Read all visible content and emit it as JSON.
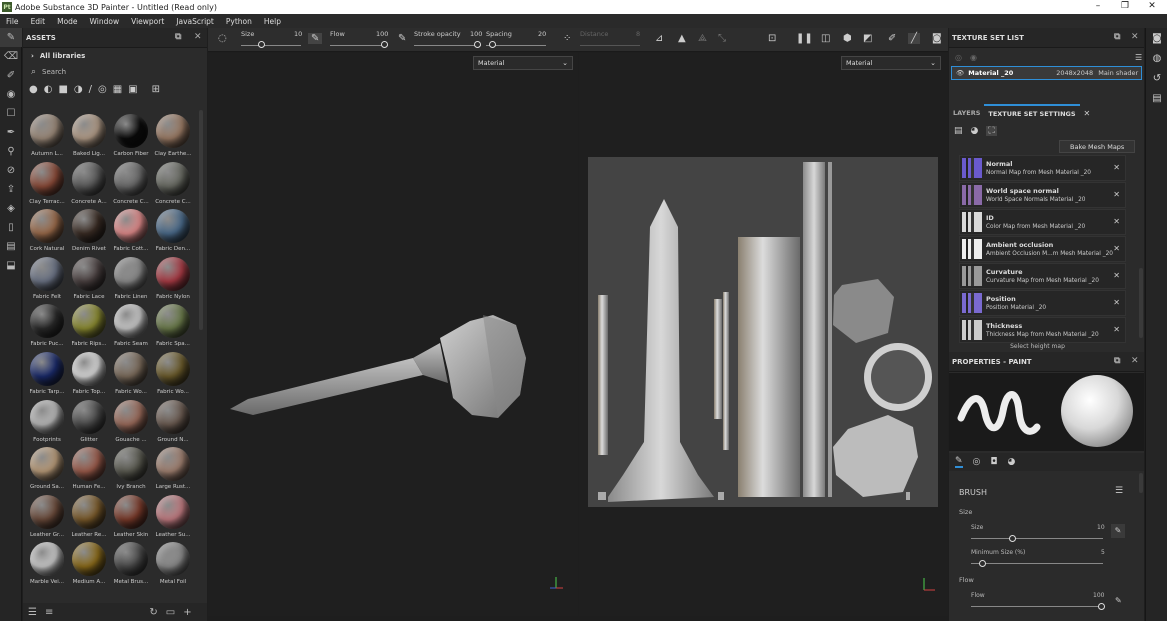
{
  "window": {
    "title": "Adobe Substance 3D Painter - Untitled (Read only)",
    "logo": "Pt",
    "minimize": "–",
    "restore": "❐",
    "close": "✕"
  },
  "menu": [
    "File",
    "Edit",
    "Mode",
    "Window",
    "Viewport",
    "JavaScript",
    "Python",
    "Help"
  ],
  "assets": {
    "title": "ASSETS",
    "library": "All libraries",
    "search_placeholder": "Search",
    "items": [
      "Autumn L...",
      "Baked Lig...",
      "Carbon Fiber",
      "Clay Earthe...",
      "Clay Terrac...",
      "Concrete A...",
      "Concrete C...",
      "Concrete C...",
      "Cork Natural",
      "Denim Rivet",
      "Fabric Cott...",
      "Fabric Den...",
      "Fabric Felt",
      "Fabric Lace",
      "Fabric Linen",
      "Fabric Nylon",
      "Fabric Puc...",
      "Fabric Rips...",
      "Fabric Seam",
      "Fabric Spa...",
      "Fabric Tarp...",
      "Fabric Top...",
      "Fabric Wo...",
      "Fabric Wo...",
      "Footprints",
      "Glitter",
      "Gouache ...",
      "Ground N...",
      "Ground Sa...",
      "Human Fe...",
      "Ivy Branch",
      "Large Rust...",
      "Leather Gr...",
      "Leather Re...",
      "Leather Skin",
      "Leather Su...",
      "Marble Vei...",
      "Medium A...",
      "Metal Brus...",
      "Metal Foil"
    ],
    "colors": [
      "#9a8878",
      "#b09a86",
      "#0a0a0a",
      "#9a7a64",
      "#8a4a38",
      "#5a5a5a",
      "#6a6a6a",
      "#686a62",
      "#9a6a4a",
      "#3a2c24",
      "#e08a8a",
      "#4a6a8a",
      "#6a7284",
      "#4a4040",
      "#8a8a8a",
      "#a83a44",
      "#2a2a2a",
      "#8a8a30",
      "#c8c8c8",
      "#6a7a4a",
      "#1a2a6a",
      "#d8d8d8",
      "#7a6a5a",
      "#6a5a2a",
      "#b8b8b8",
      "#4a4a4a",
      "#9a6a5a",
      "#6a5a50",
      "#b89a78",
      "#9a5a4a",
      "#5a5a50",
      "#a08070",
      "#6a4a3a",
      "#7a5a2a",
      "#7a3a2a",
      "#c07a80",
      "#c8c8c8",
      "#8a6a1a",
      "#4a4a4a",
      "#8a8a8a"
    ]
  },
  "toolbar": {
    "size_label": "Size",
    "size_value": "10",
    "flow_label": "Flow",
    "flow_value": "100",
    "stroke_opacity_label": "Stroke opacity",
    "stroke_opacity_value": "100",
    "spacing_label": "Spacing",
    "spacing_value": "20",
    "distance_label": "Distance",
    "distance_value": "8"
  },
  "viewport": {
    "left_mode": "Material",
    "right_mode": "Material"
  },
  "texture_set_list": {
    "title": "TEXTURE SET LIST",
    "material": "Material _20",
    "resolution": "2048x2048",
    "shader": "Main shader"
  },
  "tss": {
    "tab_layers": "LAYERS",
    "tab_settings": "TEXTURE SET SETTINGS",
    "bake_button": "Bake Mesh Maps",
    "maps": [
      {
        "name": "Normal",
        "desc": "Normal Map from Mesh Material _20"
      },
      {
        "name": "World space normal",
        "desc": "World Space Normals Material _20"
      },
      {
        "name": "ID",
        "desc": "Color Map from Mesh Material _20"
      },
      {
        "name": "Ambient occlusion",
        "desc": "Ambient Occlusion M...m Mesh Material _20"
      },
      {
        "name": "Curvature",
        "desc": "Curvature Map from Mesh Material _20"
      },
      {
        "name": "Position",
        "desc": "Position Material _20"
      },
      {
        "name": "Thickness",
        "desc": "Thickness Map from Mesh Material _20"
      }
    ],
    "select_height": "Select height map"
  },
  "properties": {
    "title": "PROPERTIES - PAINT",
    "section": "BRUSH",
    "size_group": "Size",
    "size_label": "Size",
    "size_value": "10",
    "min_size_label": "Minimum Size (%)",
    "min_size_value": "5",
    "flow_group": "Flow",
    "flow_label": "Flow",
    "flow_value": "100"
  }
}
